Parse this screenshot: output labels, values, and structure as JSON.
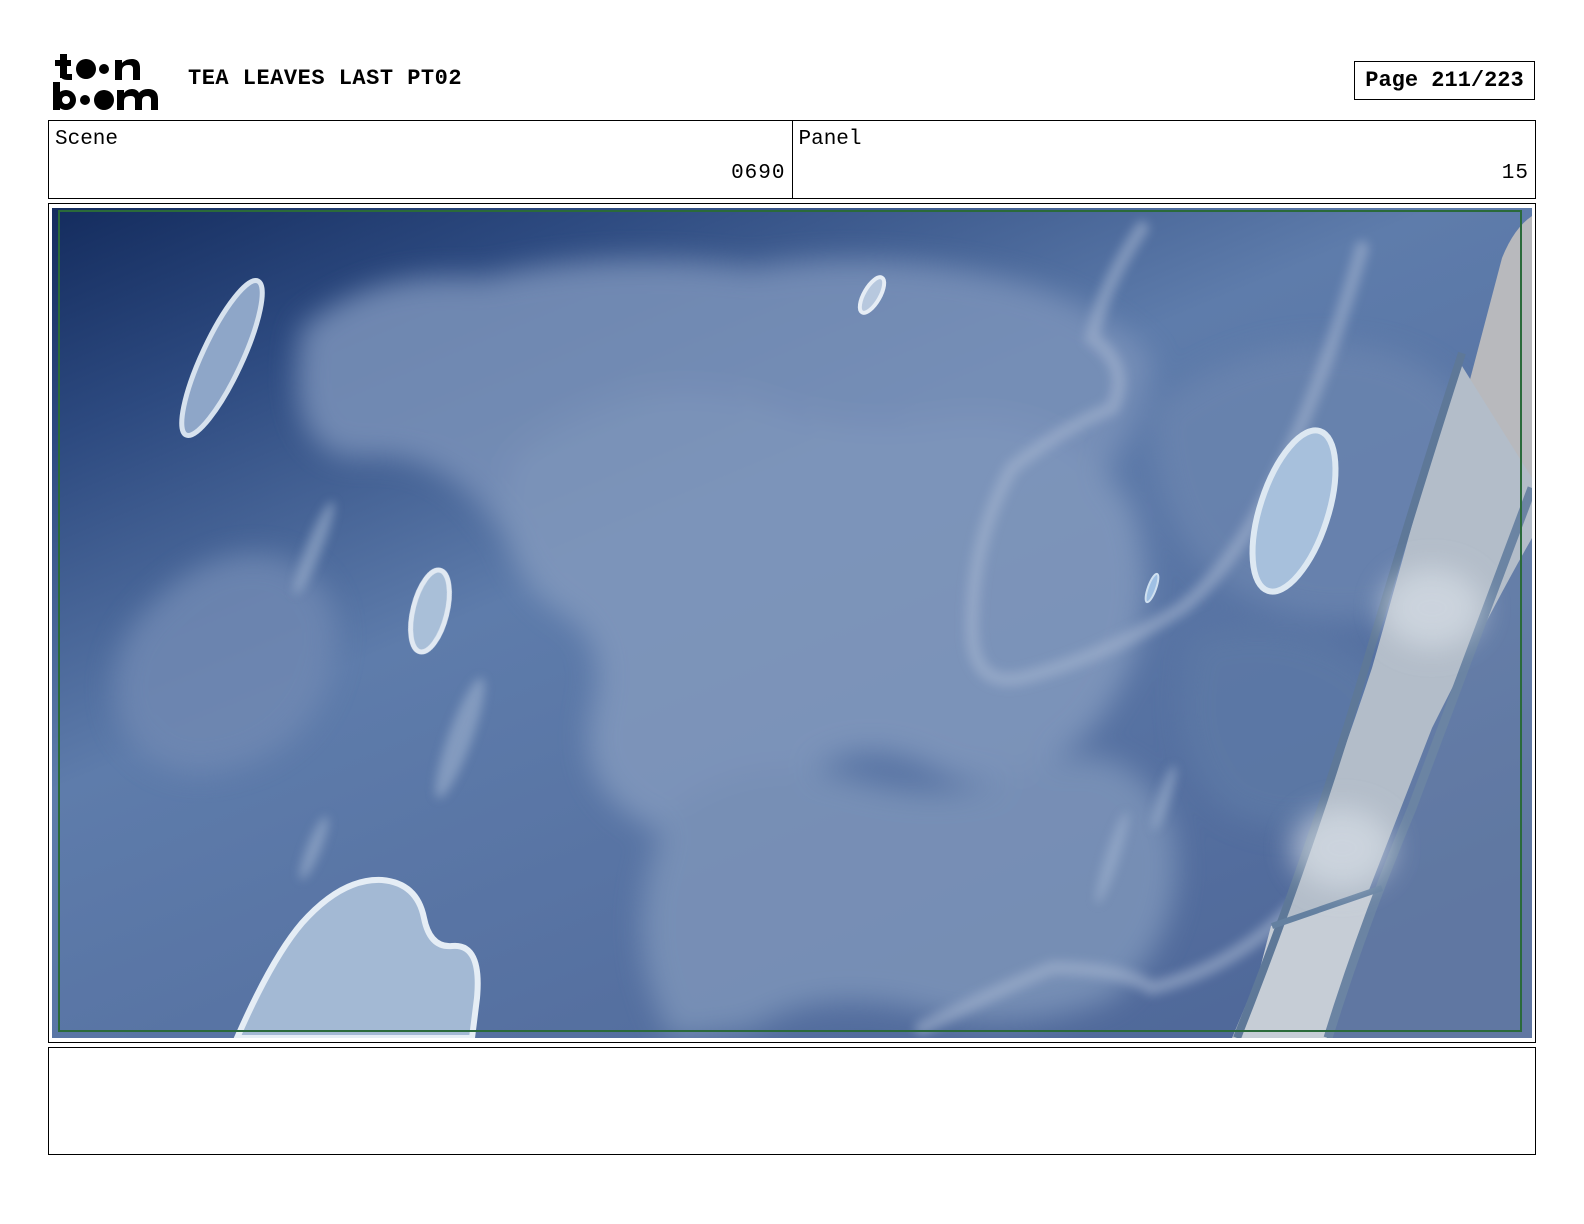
{
  "header": {
    "logo_text": "toon boom",
    "project_title": "TEA LEAVES LAST PT02",
    "page_indicator": "Page 211/223"
  },
  "info": {
    "scene_label": "Scene",
    "scene_value": "0690",
    "panel_label": "Panel",
    "panel_value": "15"
  },
  "panel_image": {
    "subject": "blue sky with clouds and window reflection",
    "palette": {
      "sky_dark": "#142c5e",
      "sky_mid": "#5b78a6",
      "cloud": "#7f97bc",
      "highlight": "#d7e2ee",
      "window_frame": "#c4cad2",
      "safe_frame": "#2a6a3a"
    }
  },
  "notes": {
    "text": ""
  }
}
